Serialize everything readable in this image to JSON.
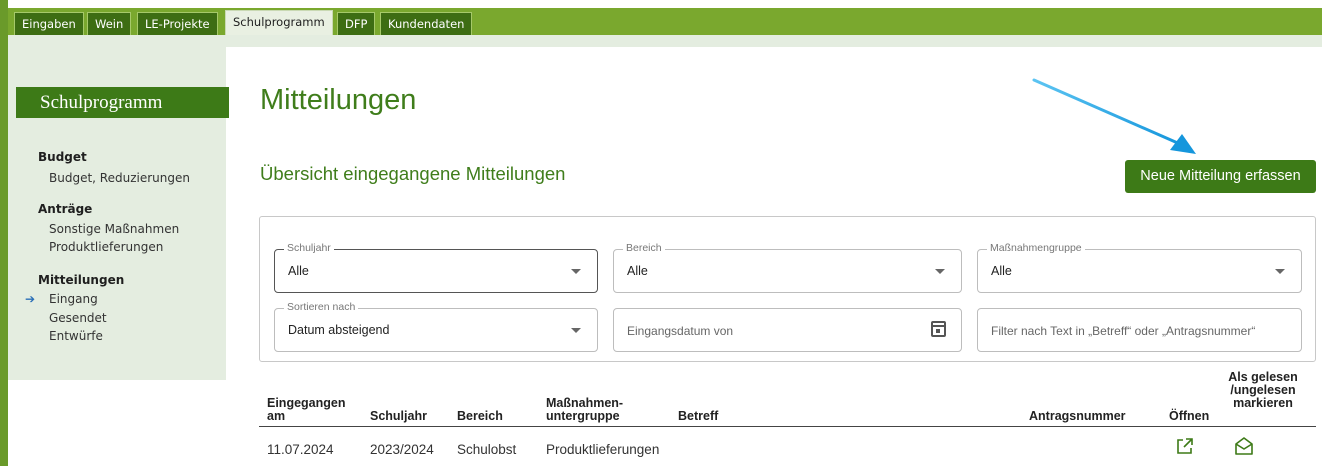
{
  "tabs": [
    {
      "label": "Eingaben",
      "active": false
    },
    {
      "label": "Wein",
      "active": false
    },
    {
      "label": "LE-Projekte",
      "active": false
    },
    {
      "label": "Schulprogramm",
      "active": true
    },
    {
      "label": "DFP",
      "active": false
    },
    {
      "label": "Kundendaten",
      "active": false
    }
  ],
  "sidebar": {
    "title": "Schulprogramm",
    "groups": [
      {
        "label": "Budget",
        "items": [
          "Budget, Reduzierungen"
        ]
      },
      {
        "label": "Anträge",
        "items": [
          "Sonstige Maßnahmen",
          "Produktlieferungen"
        ]
      },
      {
        "label": "Mitteilungen",
        "items": [
          "Eingang",
          "Gesendet",
          "Entwürfe"
        ]
      }
    ],
    "active_item": "Eingang"
  },
  "main": {
    "title": "Mitteilungen",
    "subtitle": "Übersicht eingegangene Mitteilungen",
    "new_button": "Neue Mitteilung erfassen"
  },
  "filters": {
    "schuljahr": {
      "label": "Schuljahr",
      "value": "Alle"
    },
    "bereich": {
      "label": "Bereich",
      "value": "Alle"
    },
    "massnahmengruppe": {
      "label": "Maßnahmengruppe",
      "value": "Alle"
    },
    "sortieren": {
      "label": "Sortieren nach",
      "value": "Datum absteigend"
    },
    "eingangsdatum": {
      "placeholder": "Eingangsdatum von"
    },
    "textfilter": {
      "placeholder": "Filter nach Text in „Betreff“ oder „Antragsnummer“"
    }
  },
  "table": {
    "headers": {
      "eingegangen_1": "Eingegangen",
      "eingegangen_2": "am",
      "schuljahr": "Schuljahr",
      "bereich": "Bereich",
      "massnahmen_1": "Maßnahmen-",
      "massnahmen_2": "untergruppe",
      "betreff": "Betreff",
      "antragsnummer": "Antragsnummer",
      "oeffnen": "Öffnen",
      "gelesen_1": "Als gelesen",
      "gelesen_2": "/ungelesen",
      "gelesen_3": "markieren"
    },
    "rows": [
      {
        "eingegangen": "11.07.2024",
        "schuljahr": "2023/2024",
        "bereich": "Schulobst",
        "massnahmen": "Produktlieferungen",
        "betreff": "",
        "antragsnummer": ""
      }
    ]
  },
  "colors": {
    "brand_green": "#3d7a17",
    "tabbar_green": "#7aa82e",
    "sidebar_bg": "#e4ede0",
    "annotation_blue": "#1aa3e6"
  },
  "icons": {
    "open": "external-link-icon",
    "mark_read": "envelope-open-icon",
    "calendar": "calendar-icon",
    "dropdown": "chevron-down-icon",
    "active_nav": "arrow-right-icon"
  }
}
